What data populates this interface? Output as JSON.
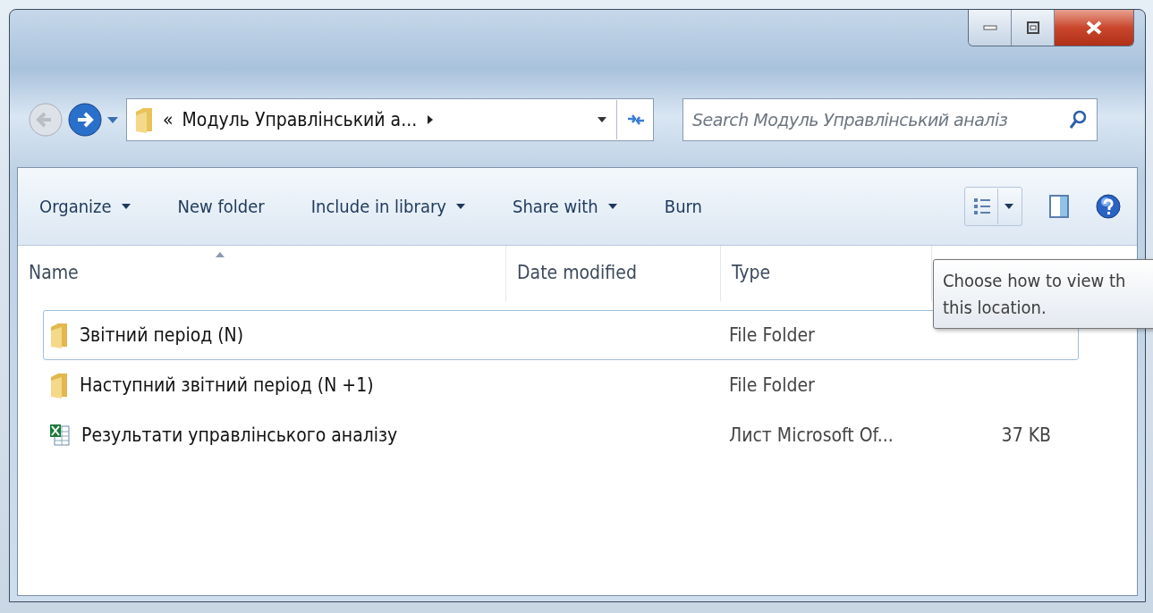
{
  "window": {
    "controls": [
      {
        "kind": "minimize"
      },
      {
        "kind": "maximize"
      },
      {
        "kind": "close"
      }
    ]
  },
  "address_bar": {
    "prefix": "«",
    "path": "Модуль Управлінський а...",
    "back_disabled": true
  },
  "search": {
    "placeholder": "Search Модуль Управлінський аналіз"
  },
  "toolbar": [
    {
      "label": "Organize",
      "dropdown": true
    },
    {
      "label": "New folder",
      "dropdown": false
    },
    {
      "label": "Include in library",
      "dropdown": true
    },
    {
      "label": "Share with",
      "dropdown": true
    },
    {
      "label": "Burn",
      "dropdown": false
    }
  ],
  "table": {
    "columns": [
      "Name",
      "Date modified",
      "Type"
    ],
    "rows": [
      {
        "kind": "folder",
        "name": "Звітний період (N)",
        "type": "File Folder",
        "selected": true
      },
      {
        "kind": "folder",
        "name": "Наступний звітний період (N +1)",
        "type": "File Folder",
        "selected": false
      },
      {
        "kind": "spreadsheet",
        "name": "Результати управлінського аналізу",
        "type": "Лист Microsoft Of...",
        "size": "37 KB",
        "selected": false
      }
    ]
  },
  "tooltip": {
    "lines": [
      "Choose how to view th",
      "this location."
    ]
  }
}
